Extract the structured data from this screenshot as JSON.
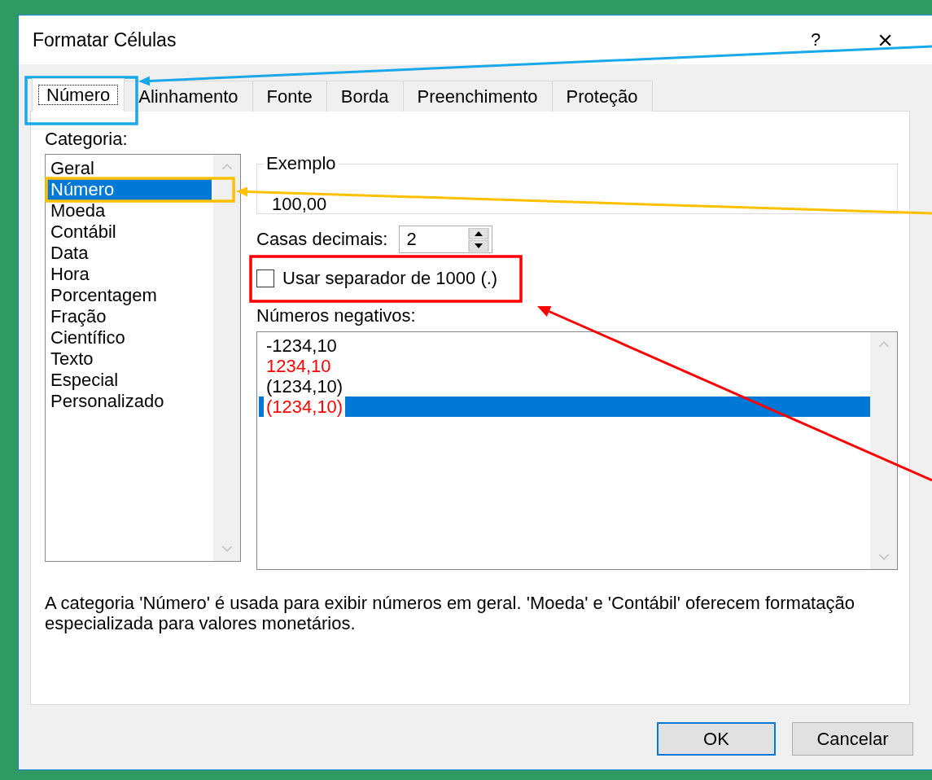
{
  "window": {
    "title": "Formatar Células",
    "help": "?",
    "close": "×"
  },
  "tabs": [
    {
      "label": "Número",
      "selected": true
    },
    {
      "label": "Alinhamento",
      "selected": false
    },
    {
      "label": "Fonte",
      "selected": false
    },
    {
      "label": "Borda",
      "selected": false
    },
    {
      "label": "Preenchimento",
      "selected": false
    },
    {
      "label": "Proteção",
      "selected": false
    }
  ],
  "category": {
    "label": "Categoria:",
    "items": [
      {
        "label": "Geral",
        "selected": false
      },
      {
        "label": "Número",
        "selected": true
      },
      {
        "label": "Moeda",
        "selected": false
      },
      {
        "label": "Contábil",
        "selected": false
      },
      {
        "label": "Data",
        "selected": false
      },
      {
        "label": "Hora",
        "selected": false
      },
      {
        "label": "Porcentagem",
        "selected": false
      },
      {
        "label": "Fração",
        "selected": false
      },
      {
        "label": "Científico",
        "selected": false
      },
      {
        "label": "Texto",
        "selected": false
      },
      {
        "label": "Especial",
        "selected": false
      },
      {
        "label": "Personalizado",
        "selected": false
      }
    ]
  },
  "sample": {
    "label": "Exemplo",
    "value": "100,00"
  },
  "decimals": {
    "label": "Casas decimais:",
    "value": "2"
  },
  "thousands_separator": {
    "label": "Usar separador de 1000 (.)",
    "checked": false
  },
  "negative_numbers": {
    "label": "Números negativos:",
    "items": [
      {
        "label": "-1234,10",
        "color": "#000000",
        "selected": false
      },
      {
        "label": "1234,10",
        "color": "#ff0000",
        "selected": false
      },
      {
        "label": "(1234,10)",
        "color": "#000000",
        "selected": false
      },
      {
        "label": "(1234,10)",
        "color": "#ff0000",
        "selected": true
      }
    ]
  },
  "description": "A categoria 'Número' é usada para exibir números em geral. 'Moeda' e 'Contábil' oferecem formatação especializada para valores monetários.",
  "buttons": [
    {
      "label": "OK",
      "default": true
    },
    {
      "label": "Cancelar",
      "default": false
    }
  ],
  "annotations": [
    {
      "kind": "tab",
      "color": "#1aa9e8"
    },
    {
      "kind": "category",
      "color": "#ffc000"
    },
    {
      "kind": "checkbox",
      "color": "#ff0000"
    }
  ]
}
